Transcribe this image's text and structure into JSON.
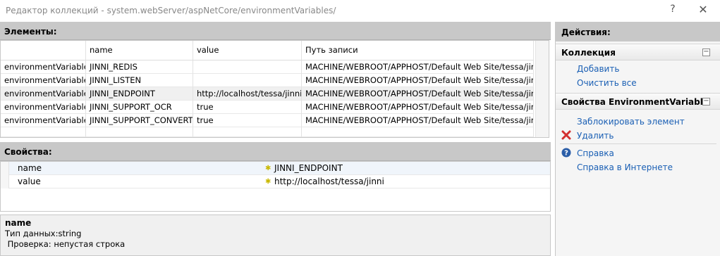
{
  "window": {
    "title": "Редактор коллекций - system.webServer/aspNetCore/environmentVariables/",
    "help_glyph": "?",
    "close_glyph": "✕"
  },
  "elements_panel": {
    "title": "Элементы:",
    "columns": [
      "",
      "name",
      "value",
      "Путь записи"
    ],
    "rows": [
      [
        "environmentVariable",
        "JINNI_REDIS",
        "",
        "MACHINE/WEBROOT/APPHOST/Default Web Site/tessa/jinni"
      ],
      [
        "environmentVariable",
        "JINNI_LISTEN",
        "",
        "MACHINE/WEBROOT/APPHOST/Default Web Site/tessa/jinni"
      ],
      [
        "environmentVariable",
        "JINNI_ENDPOINT",
        "http://localhost/tessa/jinni",
        "MACHINE/WEBROOT/APPHOST/Default Web Site/tessa/jinni"
      ],
      [
        "environmentVariable",
        "JINNI_SUPPORT_OCR",
        "true",
        "MACHINE/WEBROOT/APPHOST/Default Web Site/tessa/jinni"
      ],
      [
        "environmentVariable",
        "JINNI_SUPPORT_CONVERT",
        "true",
        "MACHINE/WEBROOT/APPHOST/Default Web Site/tessa/jinni"
      ]
    ],
    "selected_row_index": 2
  },
  "properties_panel": {
    "title": "Свойства:",
    "rows": [
      {
        "name": "name",
        "value": "JINNI_ENDPOINT"
      },
      {
        "name": "value",
        "value": "http://localhost/tessa/jinni"
      }
    ]
  },
  "description": {
    "name": "name",
    "line1": "Тип данных:string",
    "line2": " Проверка: непустая строка"
  },
  "actions": {
    "title": "Действия:",
    "collection_section": {
      "title": "Коллекция",
      "add": "Добавить",
      "clear": "Очистить все"
    },
    "item_section": {
      "title": "Свойства EnvironmentVariable",
      "lock": "Заблокировать элемент",
      "delete": "Удалить",
      "help": "Справка",
      "online_help": "Справка в Интернете"
    }
  },
  "colors": {
    "link": "#1a5fb4",
    "header_gray": "#c8c8c8",
    "required_star": "#c9b800",
    "delete_red": "#d32f2f",
    "help_blue": "#2b5ea8"
  }
}
